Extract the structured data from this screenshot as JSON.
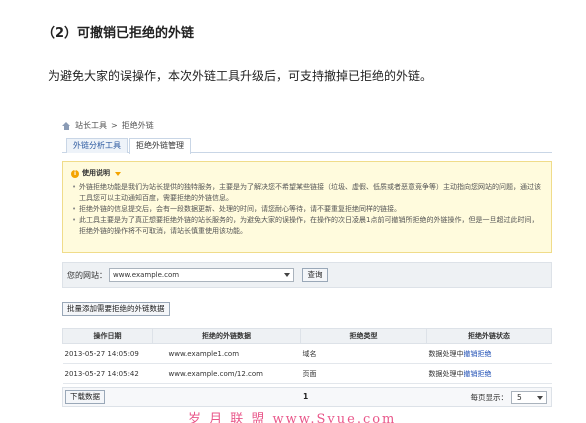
{
  "heading": "（2）可撤销已拒绝的外链",
  "intro": "为避免大家的误操作，本次外链工具升级后，可支持撤掉已拒绝的外链。",
  "breadcrumb": {
    "root": "站长工具",
    "separator": ">",
    "current": "拒绝外链"
  },
  "tabs": [
    {
      "label": "外链分析工具"
    },
    {
      "label": "拒绝外链管理",
      "active": true
    }
  ],
  "notice": {
    "title": "使用说明",
    "items": [
      "外链拒绝功能是我们为站长提供的独特服务，主要是为了解决您不希望某些链接（垃圾、虚假、低质或者恶意竞争等）主动指向您网站的问题，通过该工具您可以主动通知百度，需要拒绝的外链信息。",
      "拒绝外链的信息提交后，会有一段数据更新、处理的时间，请您耐心等待，请不要重复拒绝同样的链接。",
      "此工具主要是为了真正想要拒绝外链的站长服务的，为避免大家的误操作，在操作的次日凌晨1点前可撤销所拒绝的外链操作，但是一旦超过此时间，拒绝外链的操作将不可取消，请站长慎重使用该功能。"
    ]
  },
  "site_filter": {
    "label": "您的网站：",
    "value": "www.example.com",
    "query_label": "查询"
  },
  "bulk_add_label": "批量添加需要拒绝的外链数据",
  "table": {
    "headers": [
      "操作日期",
      "拒绝的外链数据",
      "拒绝类型",
      "拒绝外链状态"
    ],
    "rows": [
      {
        "date": "2013-05-27 14:05:09",
        "link": "www.example1.com",
        "type": "域名",
        "status": "数据处理中",
        "action": "撤销拒绝"
      },
      {
        "date": "2013-05-27 14:05:42",
        "link": "www.example.com/12.com",
        "type": "页面",
        "status": "数据处理中",
        "action": "撤销拒绝"
      }
    ]
  },
  "footer": {
    "download_label": "下载数据",
    "page": "1",
    "per_page_label": "每页显示：",
    "per_page_value": "5"
  },
  "watermark": "岁 月 联 盟  www.Syue.com",
  "colors": {
    "link": "#1f4fb5",
    "notice_bg": "#fffbdd",
    "watermark": "#e9578a"
  }
}
